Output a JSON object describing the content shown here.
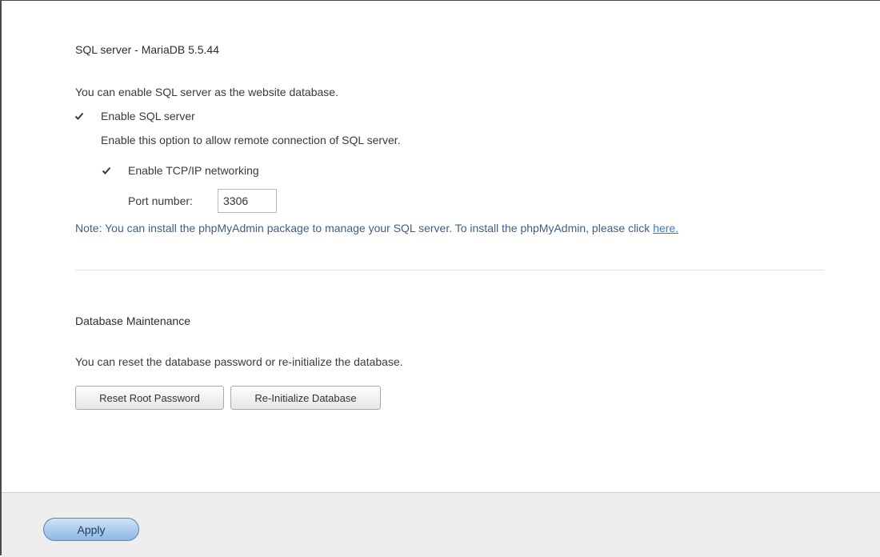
{
  "sql_section": {
    "title": "SQL server - MariaDB 5.5.44",
    "description": "You can enable SQL server as the website database.",
    "enable_sql": {
      "label": "Enable SQL server",
      "checked": true
    },
    "enable_sql_hint": "Enable this option to allow remote connection of SQL server.",
    "enable_tcp": {
      "label": "Enable TCP/IP networking",
      "checked": true
    },
    "port_label": "Port number:",
    "port_value": "3306",
    "note_text": "Note: You can install the phpMyAdmin package to manage your SQL server. To install the phpMyAdmin, please click ",
    "note_link": "here."
  },
  "maintenance_section": {
    "title": "Database Maintenance",
    "description": "You can reset the database password or re-initialize the database.",
    "reset_button": "Reset Root Password",
    "reinit_button": "Re-Initialize Database"
  },
  "footer": {
    "apply_button": "Apply"
  },
  "colors": {
    "note_text": "#3b5f8a",
    "link": "#2a7fd4",
    "footer_bg": "#eeeeee",
    "apply_button": "#8db7e6"
  }
}
